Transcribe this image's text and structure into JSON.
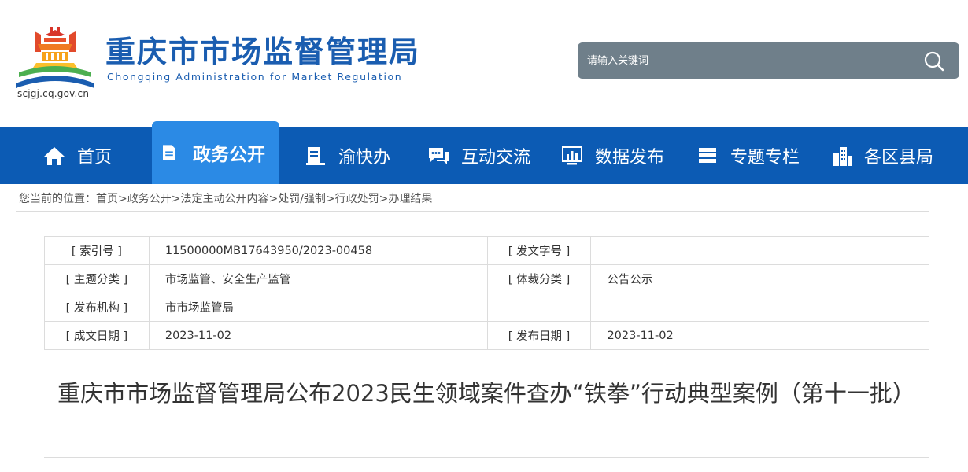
{
  "header": {
    "site_title": "重庆市市场监督管理局",
    "site_subtitle": "Chongqing  Administration for Market Regulation",
    "domain": "scjgj.cq.gov.cn",
    "brand_blue": "#1a5db0",
    "logo_icon": "temple-logo-icon"
  },
  "search": {
    "placeholder": "请输入关键词",
    "icon": "search-icon"
  },
  "nav": {
    "items": [
      {
        "label": "首页",
        "icon": "home-icon"
      },
      {
        "label": "政务公开",
        "icon": "document-icon",
        "active": true
      },
      {
        "label": "渝快办",
        "icon": "service-icon"
      },
      {
        "label": "互动交流",
        "icon": "chat-icon"
      },
      {
        "label": "数据发布",
        "icon": "chart-icon"
      },
      {
        "label": "专题专栏",
        "icon": "column-icon"
      },
      {
        "label": "各区县局",
        "icon": "building-icon"
      }
    ],
    "bg_color": "#0c5bb4",
    "active_color": "#2b8ae5"
  },
  "breadcrumb": {
    "prefix": "您当前的位置：",
    "items": [
      "首页",
      "政务公开",
      "法定主动公开内容",
      "处罚/强制",
      "行政处罚",
      "办理结果"
    ],
    "separator": ">"
  },
  "meta": {
    "rows": [
      {
        "label1": "[ 索引号 ]",
        "value1": "11500000MB17643950/2023-00458",
        "label2": "[ 发文字号 ]",
        "value2": ""
      },
      {
        "label1": "[ 主题分类 ]",
        "value1": "市场监管、安全生产监管",
        "label2": "[ 体裁分类 ]",
        "value2": "公告公示"
      },
      {
        "label1": "[ 发布机构 ]",
        "value1": "市市场监管局",
        "label2": "",
        "value2": ""
      },
      {
        "label1": "[ 成文日期 ]",
        "value1": "2023-11-02",
        "label2": "[ 发布日期 ]",
        "value2": "2023-11-02"
      }
    ]
  },
  "article": {
    "title": "重庆市市场监督管理局公布2023民生领域案件查办“铁拳”行动典型案例（第十一批）"
  }
}
